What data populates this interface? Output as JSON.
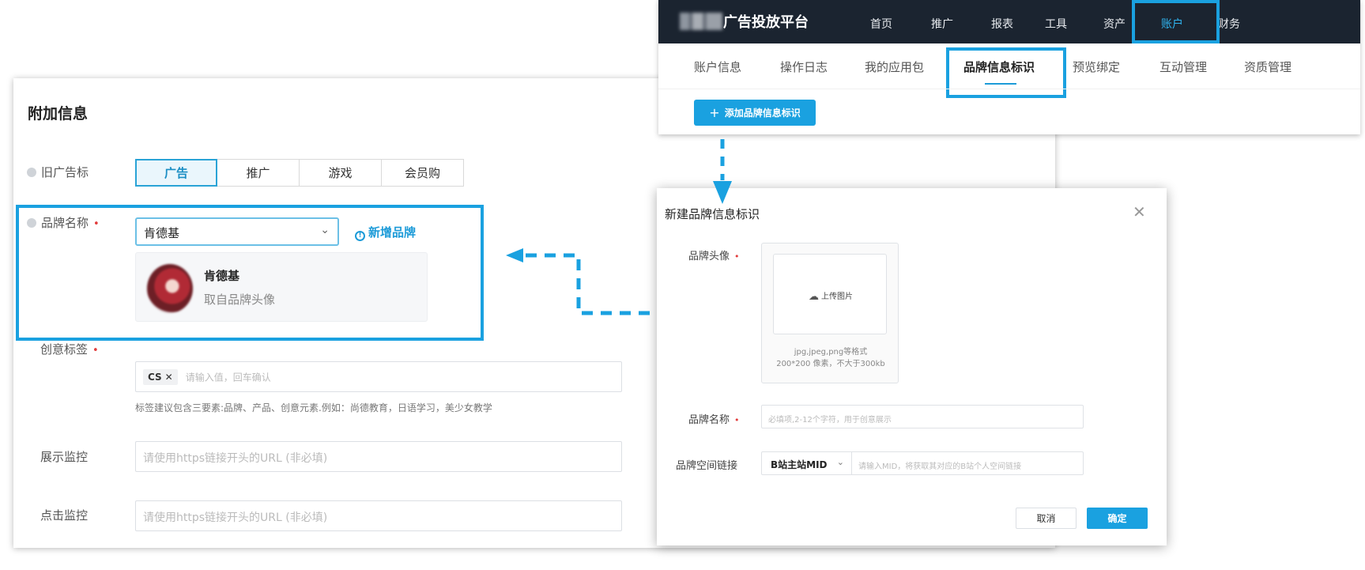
{
  "form": {
    "title": "附加信息",
    "old_ad_label": "旧广告标",
    "segments": [
      "广告",
      "推广",
      "游戏",
      "会员购"
    ],
    "brand_name_label": "品牌名称",
    "required_mark": "•",
    "brand_select_value": "肯德基",
    "new_brand_link": "新增品牌",
    "brand_card": {
      "name": "肯德基",
      "subtitle": "取自品牌头像"
    },
    "creative_tag_label": "创意标签",
    "creative_tag_chip": "CS",
    "creative_tag_placeholder": "请输入值，回车确认",
    "creative_tag_hint": "标签建议包含三要素:品牌、产品、创意元素.例如：尚德教育，日语学习，美少女教学",
    "display_monitor_label": "展示监控",
    "display_monitor_placeholder": "请使用https链接开头的URL (非必填)",
    "click_monitor_label": "点击监控",
    "click_monitor_placeholder": "请使用https链接开头的URL (非必填)"
  },
  "header": {
    "platform_title": "广告投放平台",
    "nav": [
      "首页",
      "推广",
      "报表",
      "工具",
      "资产",
      "账户",
      "财务"
    ],
    "active_nav": "账户",
    "sub_tabs": [
      "账户信息",
      "操作日志",
      "我的应用包",
      "品牌信息标识",
      "预览绑定",
      "互动管理",
      "资质管理"
    ],
    "active_sub_tab": "品牌信息标识",
    "add_button": "添加品牌信息标识"
  },
  "modal": {
    "title": "新建品牌信息标识",
    "avatar_label": "品牌头像",
    "upload_text": "上传图片",
    "upload_hint_formats": "jpg,jpeg,png等格式",
    "upload_hint_size": "200*200 像素，不大于300kb",
    "name_label": "品牌名称",
    "name_placeholder": "必填项,2-12个字符，用于创意展示",
    "space_link_label": "品牌空间链接",
    "space_link_select": "B站主站MID",
    "space_link_placeholder": "请输入MID，将获取其对应的B站个人空间链接",
    "cancel": "取消",
    "confirm": "确定"
  },
  "colors": {
    "accent": "#1aa1e0",
    "header_bg": "#1b2430",
    "required": "#e23c3c"
  }
}
